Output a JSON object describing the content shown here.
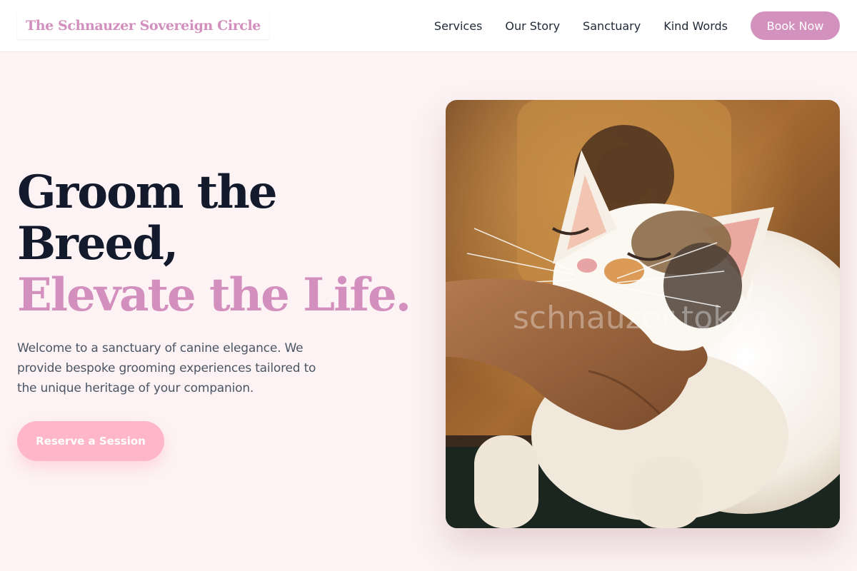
{
  "header": {
    "logo": "The Schnauzer Sovereign Circle",
    "nav": [
      "Services",
      "Our Story",
      "Sanctuary",
      "Kind Words"
    ],
    "cta_label": "Book Now"
  },
  "hero": {
    "title_line1": "Groom the",
    "title_line2": "Breed,",
    "title_accent": "Elevate the Life.",
    "description": "Welcome to a sanctuary of canine elegance. We provide bespoke grooming experiences tailored to the unique heritage of your companion.",
    "cta_label": "Reserve a Session"
  },
  "image": {
    "watermark": "schnauzer.tokyo"
  },
  "colors": {
    "background": "#fdf3f4",
    "accent_pink": "#d38fbd",
    "cta_pink": "#ffb6c8",
    "heading": "#131a2b"
  }
}
